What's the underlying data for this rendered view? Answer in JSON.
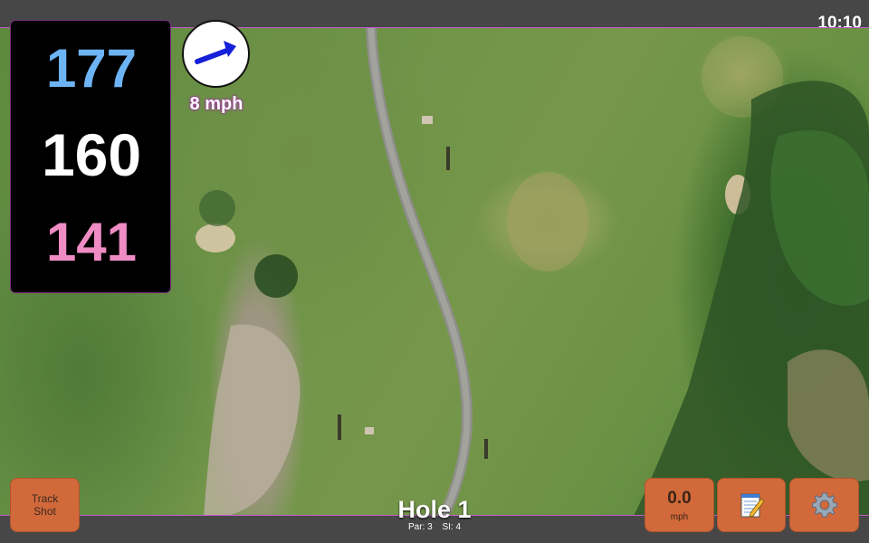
{
  "status_bar": {
    "time": "10:10"
  },
  "distances": {
    "back": "177",
    "middle": "160",
    "front": "141"
  },
  "wind": {
    "speed_label": "8 mph"
  },
  "hole": {
    "title": "Hole 1",
    "par_label": "Par: 3",
    "si_label": "SI: 4"
  },
  "buttons": {
    "track_shot": {
      "line1": "Track",
      "line2": "Shot"
    },
    "speed": {
      "value": "0.0",
      "unit": "mph"
    },
    "notes_icon": "notepad-icon",
    "settings_icon": "gear-icon"
  },
  "colors": {
    "back_distance": "#6db4f4",
    "middle_distance": "#ffffff",
    "front_distance": "#ef8cc4",
    "button": "#d1693b",
    "wind_arrow": "#1520d8"
  }
}
